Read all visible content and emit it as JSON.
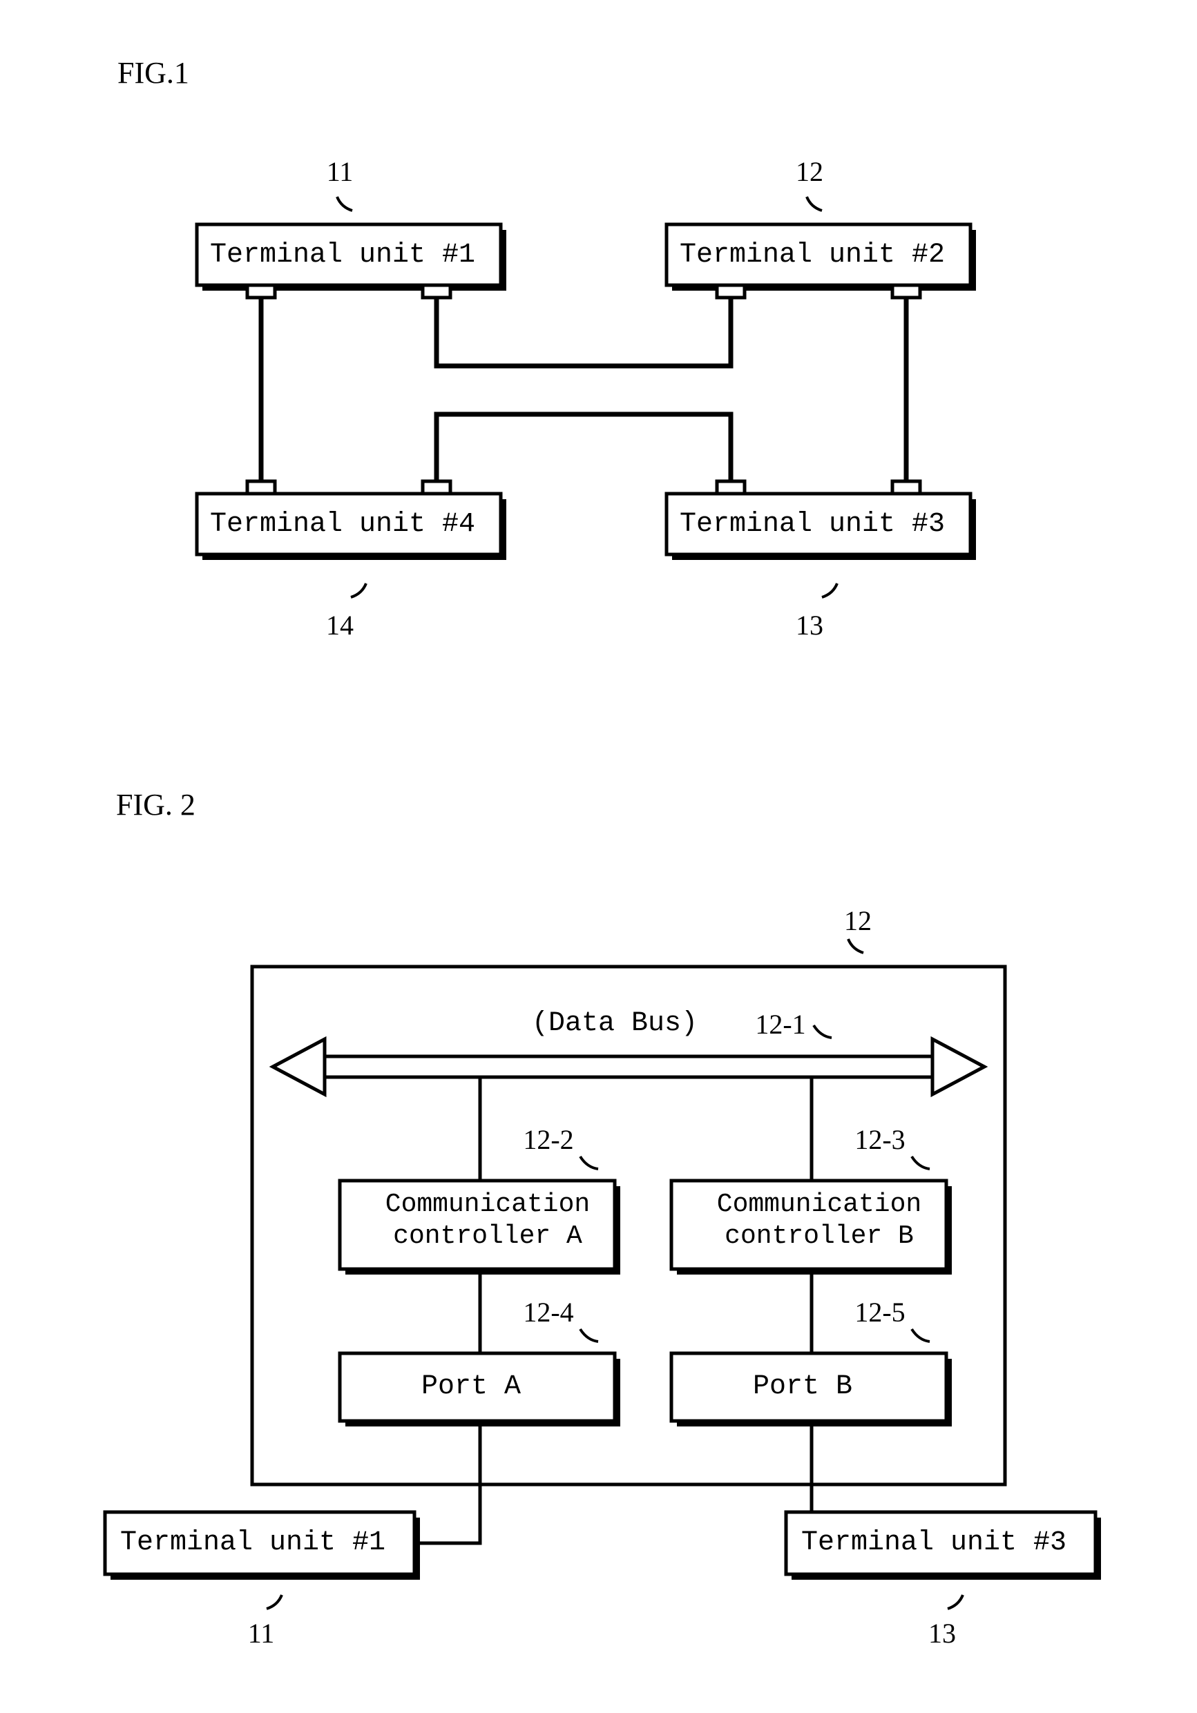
{
  "fig1": {
    "title": "FIG.1",
    "boxes": {
      "tu1": {
        "label": "Terminal unit #1",
        "ref": "11"
      },
      "tu2": {
        "label": "Terminal unit #2",
        "ref": "12"
      },
      "tu3": {
        "label": "Terminal unit #3",
        "ref": "13"
      },
      "tu4": {
        "label": "Terminal unit #4",
        "ref": "14"
      }
    }
  },
  "fig2": {
    "title": "FIG. 2",
    "outer_ref": "12",
    "databus": {
      "label": "(Data Bus)",
      "ref": "12-1"
    },
    "ccA": {
      "line1": "Communication",
      "line2": "controller A",
      "ref": "12-2"
    },
    "ccB": {
      "line1": "Communication",
      "line2": "controller B",
      "ref": "12-3"
    },
    "portA": {
      "label": "Port A",
      "ref": "12-4"
    },
    "portB": {
      "label": "Port B",
      "ref": "12-5"
    },
    "ext1": {
      "label": "Terminal unit #1",
      "ref": "11"
    },
    "ext3": {
      "label": "Terminal unit #3",
      "ref": "13"
    }
  }
}
